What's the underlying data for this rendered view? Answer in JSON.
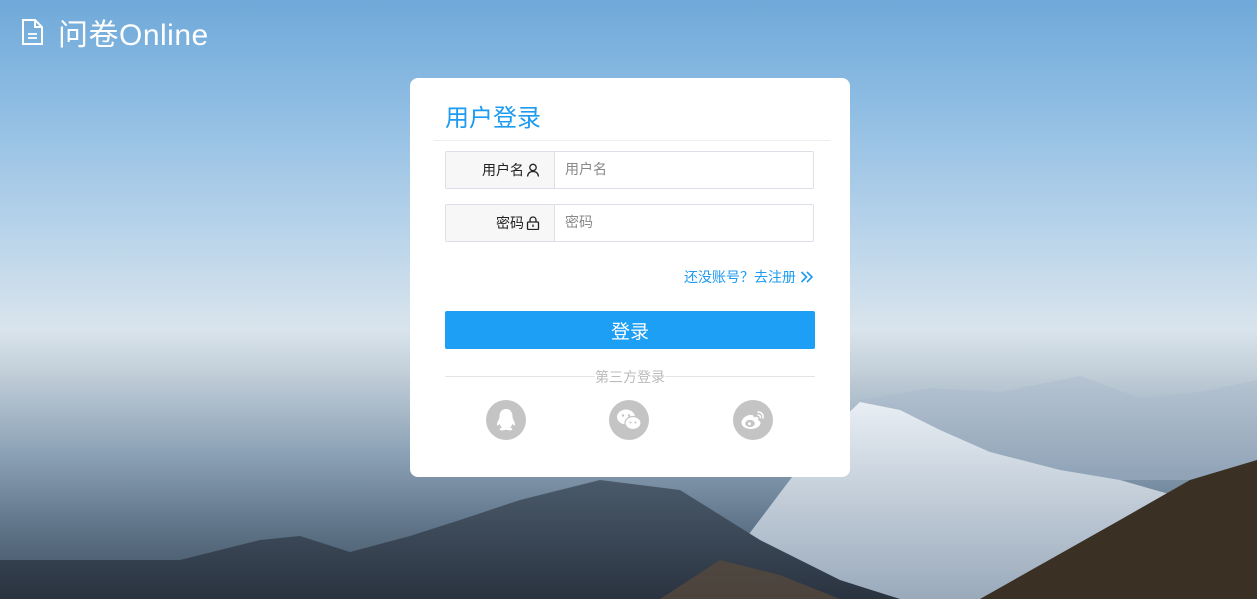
{
  "brand": {
    "name": "问卷Online",
    "icon": "document-icon"
  },
  "login": {
    "title": "用户登录",
    "username": {
      "label": "用户名",
      "placeholder": "用户名",
      "icon": "user-icon"
    },
    "password": {
      "label": "密码",
      "placeholder": "密码",
      "icon": "lock-icon"
    },
    "register_link": "还没账号？去注册",
    "submit_label": "登录",
    "third_party_label": "第三方登录",
    "social": [
      "qq-icon",
      "wechat-icon",
      "weibo-icon"
    ]
  },
  "colors": {
    "accent": "#1d9ff5",
    "social_bg": "#c4c4c4"
  }
}
